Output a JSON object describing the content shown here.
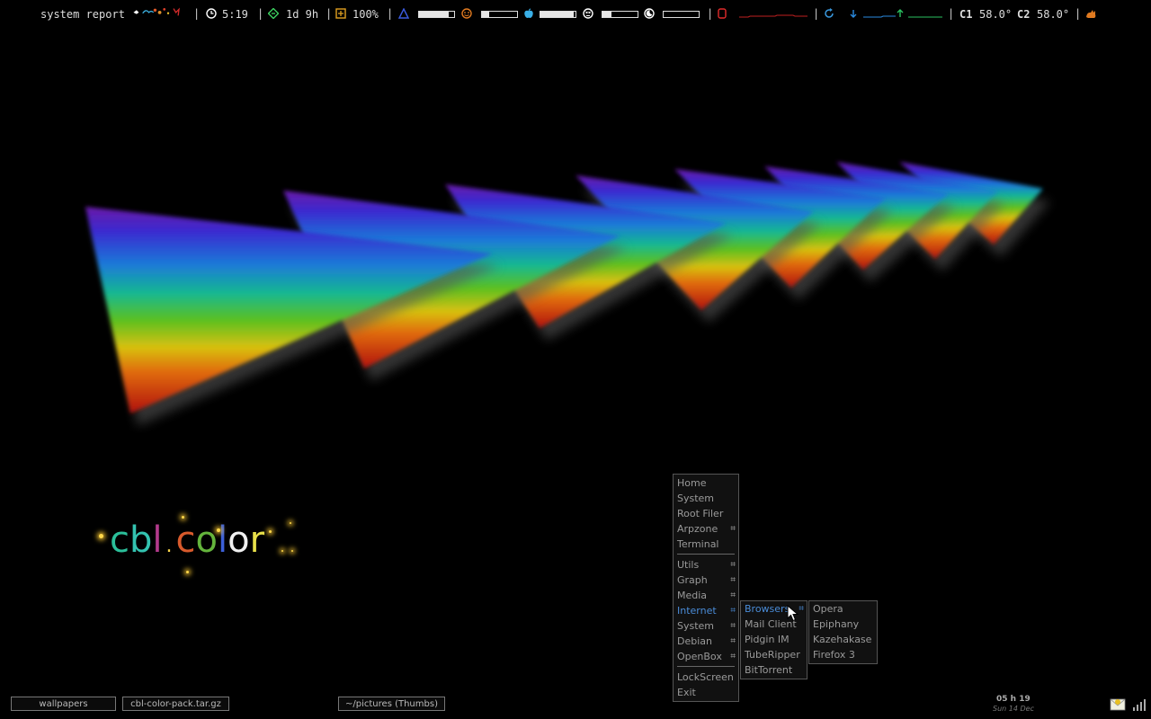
{
  "topbar": {
    "title": "system report",
    "time": "5:19",
    "uptime": "1d 9h",
    "battery": "100%",
    "meter1": 0.85,
    "meter2": 0.2,
    "meter3": 0.95,
    "meter4": 0.25,
    "meter5": 0.0,
    "cpu1_label": "C1",
    "cpu1_temp": "58.0°",
    "cpu2_label": "C2",
    "cpu2_temp": "58.0°",
    "separator": "|",
    "accent": "#e05a2a"
  },
  "wallpaper": {
    "logo_parts": [
      {
        "ch": "c",
        "color": "#2bbf9a"
      },
      {
        "ch": "b",
        "color": "#33c3b0"
      },
      {
        "ch": "l",
        "color": "#b33a8c"
      },
      {
        "ch": ".",
        "color": "#ffd84a"
      },
      {
        "ch": "c",
        "color": "#d85a2c"
      },
      {
        "ch": "o",
        "color": "#64b43c"
      },
      {
        "ch": "l",
        "color": "#3c5fd8"
      },
      {
        "ch": "o",
        "color": "#f0f0f0"
      },
      {
        "ch": "r",
        "color": "#e8e04a"
      }
    ]
  },
  "menu_main": {
    "items": [
      {
        "label": "Home",
        "submenu": false
      },
      {
        "label": "System",
        "submenu": false
      },
      {
        "label": "Root Filer",
        "submenu": false
      },
      {
        "label": "Arpzone",
        "submenu": true
      },
      {
        "label": "Terminal",
        "submenu": false
      },
      {
        "divider": true
      },
      {
        "label": "Utils",
        "submenu": true
      },
      {
        "label": "Graph",
        "submenu": true
      },
      {
        "label": "Media",
        "submenu": true
      },
      {
        "label": "Internet",
        "submenu": true,
        "active": true
      },
      {
        "label": "System",
        "submenu": true
      },
      {
        "label": "Debian",
        "submenu": true
      },
      {
        "label": "OpenBox",
        "submenu": true
      },
      {
        "divider": true
      },
      {
        "label": "LockScreen",
        "submenu": false
      },
      {
        "label": "Exit",
        "submenu": false
      }
    ],
    "submenu_glyph": "⌗"
  },
  "menu_internet": {
    "items": [
      {
        "label": "Browsers",
        "submenu": true,
        "active": true
      },
      {
        "label": "Mail Client",
        "submenu": false
      },
      {
        "label": "Pidgin IM",
        "submenu": false
      },
      {
        "label": "TubeRipper",
        "submenu": false
      },
      {
        "label": "BitTorrent",
        "submenu": false
      }
    ]
  },
  "menu_browsers": {
    "items": [
      {
        "label": "Opera"
      },
      {
        "label": "Epiphany"
      },
      {
        "label": "Kazehakase"
      },
      {
        "label": "Firefox 3"
      }
    ]
  },
  "taskbar": {
    "tasks": [
      "wallpapers",
      "cbl-color-pack.tar.gz",
      "~/pictures (Thumbs)"
    ],
    "clock_time": "05 h 19",
    "clock_date": "Sun 14 Dec"
  },
  "colors": {
    "menu_active": "#4a8cd8",
    "menu_text": "#9a9a9a"
  }
}
